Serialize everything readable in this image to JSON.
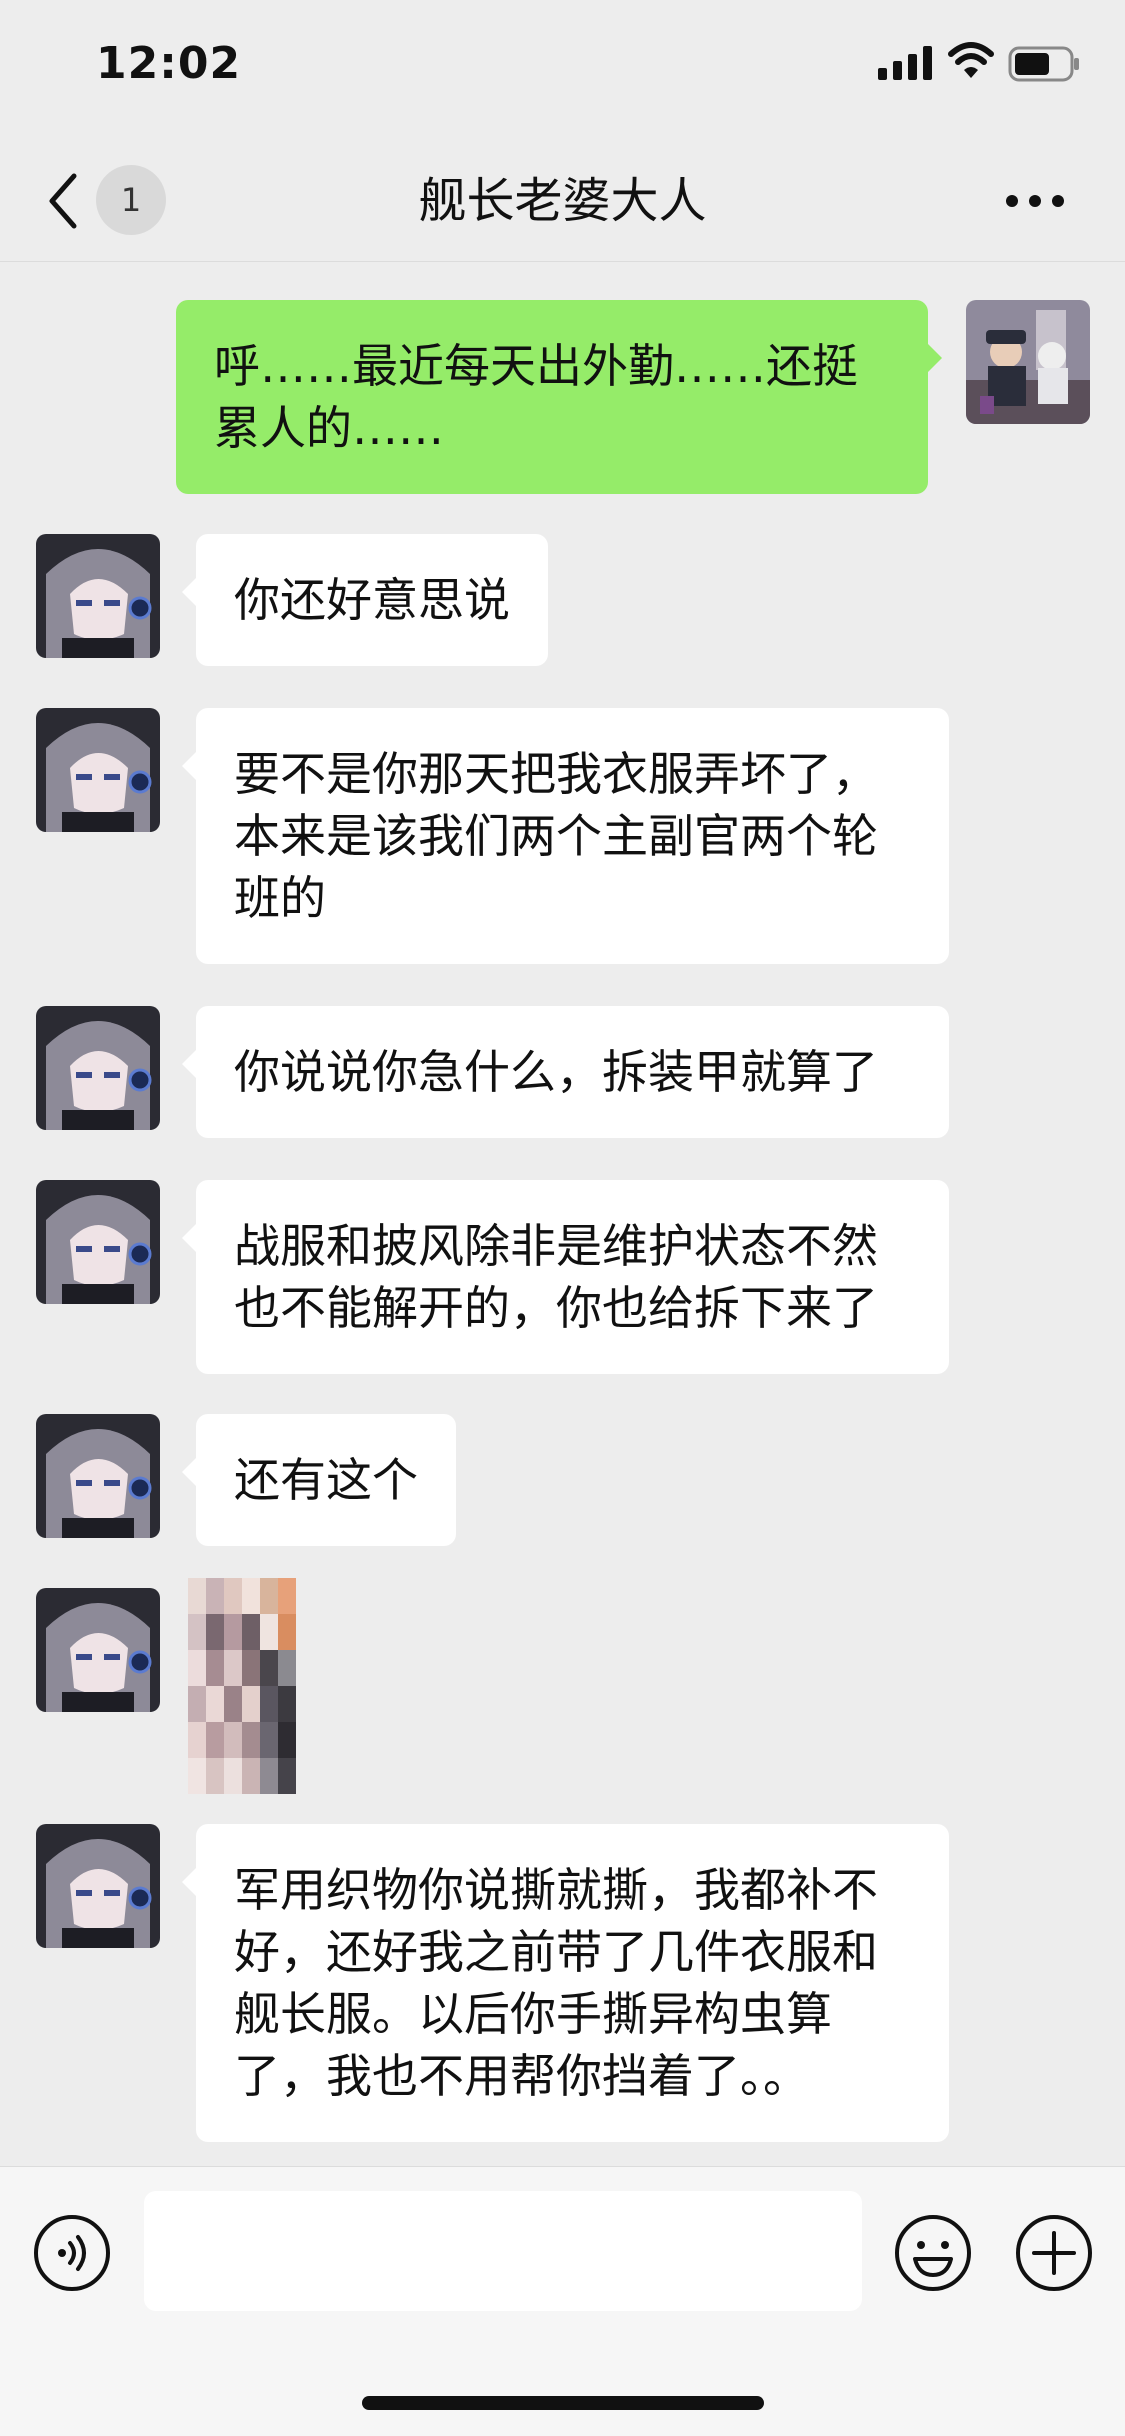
{
  "status_bar": {
    "time": "12:02",
    "icons": [
      "signal-icon",
      "wifi-icon",
      "battery-icon"
    ]
  },
  "nav": {
    "back_icon": "chevron-left-icon",
    "unread_count": "1",
    "title": "舰长老婆大人",
    "more_icon": "more-dots-icon"
  },
  "messages": [
    {
      "sender": "self",
      "text": "呼……最近每天出外勤……还挺\n累人的……"
    },
    {
      "sender": "other",
      "text": "你还好意思说"
    },
    {
      "sender": "other",
      "text": "要不是你那天把我衣服弄坏了，\n本来是该我们两个主副官两个轮\n班的"
    },
    {
      "sender": "other",
      "text": "你说说你急什么，拆装甲就算了"
    },
    {
      "sender": "other",
      "text": "战服和披风除非是维护状态不然\n也不能解开的，你也给拆下来了"
    },
    {
      "sender": "other",
      "text": "还有这个"
    },
    {
      "sender": "other",
      "type": "image",
      "description": "pixelated-sticker"
    },
    {
      "sender": "other",
      "text": "军用织物你说撕就撕，我都补不\n好，还好我之前带了几件衣服和\n舰长服。以后你手撕异构虫算\n了，我也不用帮你挡着了。。"
    }
  ],
  "input_bar": {
    "input_value": "",
    "voice_icon": "voice-icon",
    "emoji_icon": "emoji-icon",
    "plus_icon": "plus-icon"
  },
  "colors": {
    "background": "#ededed",
    "self_bubble": "#95ec69",
    "other_bubble": "#ffffff",
    "input_bar": "#f6f6f6"
  }
}
